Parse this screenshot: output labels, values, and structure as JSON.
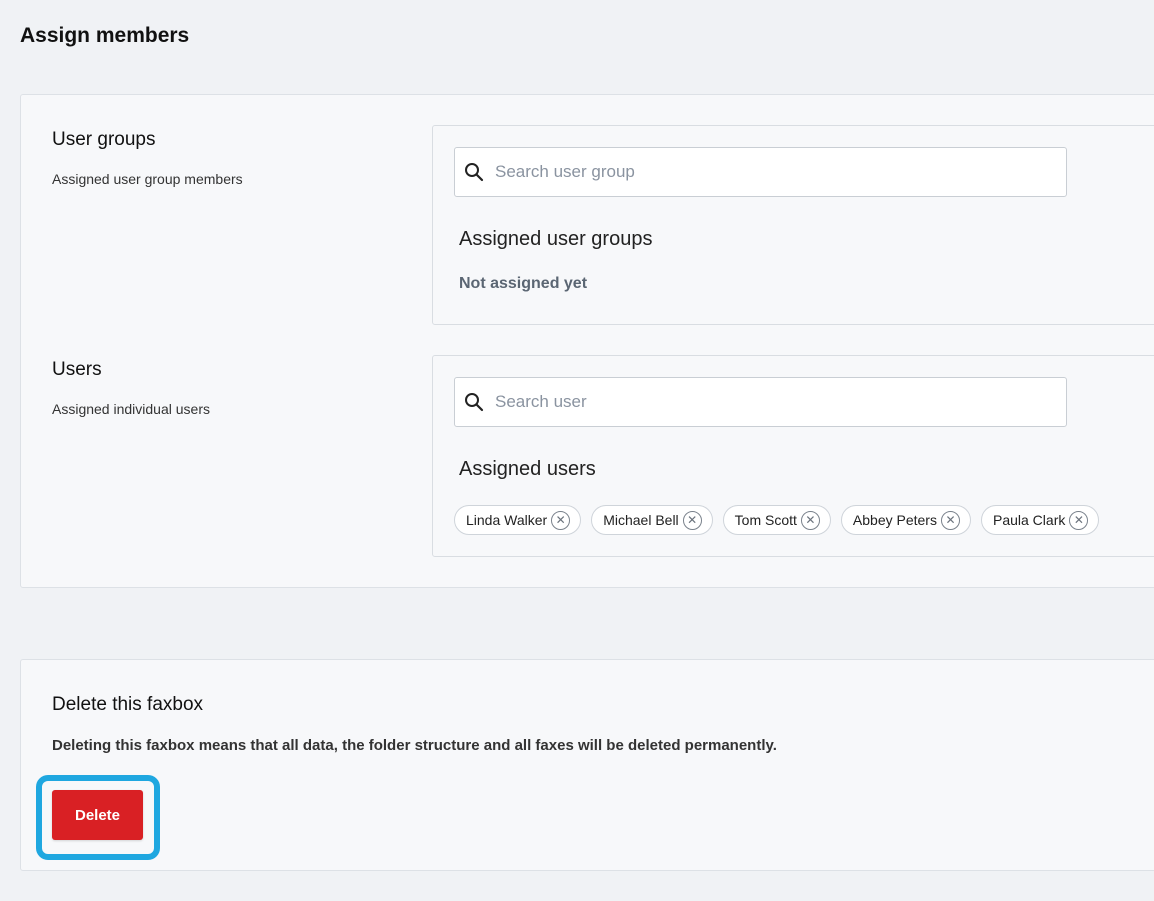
{
  "page": {
    "title": "Assign members"
  },
  "user_groups": {
    "title": "User groups",
    "subtitle": "Assigned user group members",
    "search_placeholder": "Search user group",
    "assigned_heading": "Assigned user groups",
    "empty_text": "Not assigned yet"
  },
  "users": {
    "title": "Users",
    "subtitle": "Assigned individual users",
    "search_placeholder": "Search user",
    "assigned_heading": "Assigned users",
    "assigned": [
      {
        "name": "Linda Walker"
      },
      {
        "name": "Michael Bell"
      },
      {
        "name": "Tom Scott"
      },
      {
        "name": "Abbey Peters"
      },
      {
        "name": "Paula Clark"
      }
    ]
  },
  "delete_section": {
    "title": "Delete this faxbox",
    "description": "Deleting this faxbox means that all data, the folder structure and all faxes will be deleted permanently.",
    "button_label": "Delete"
  },
  "icons": {
    "search": "search-icon",
    "remove": "close-circle-icon"
  },
  "colors": {
    "danger": "#d92024",
    "highlight": "#1fa7e0",
    "background": "#f0f2f5"
  }
}
